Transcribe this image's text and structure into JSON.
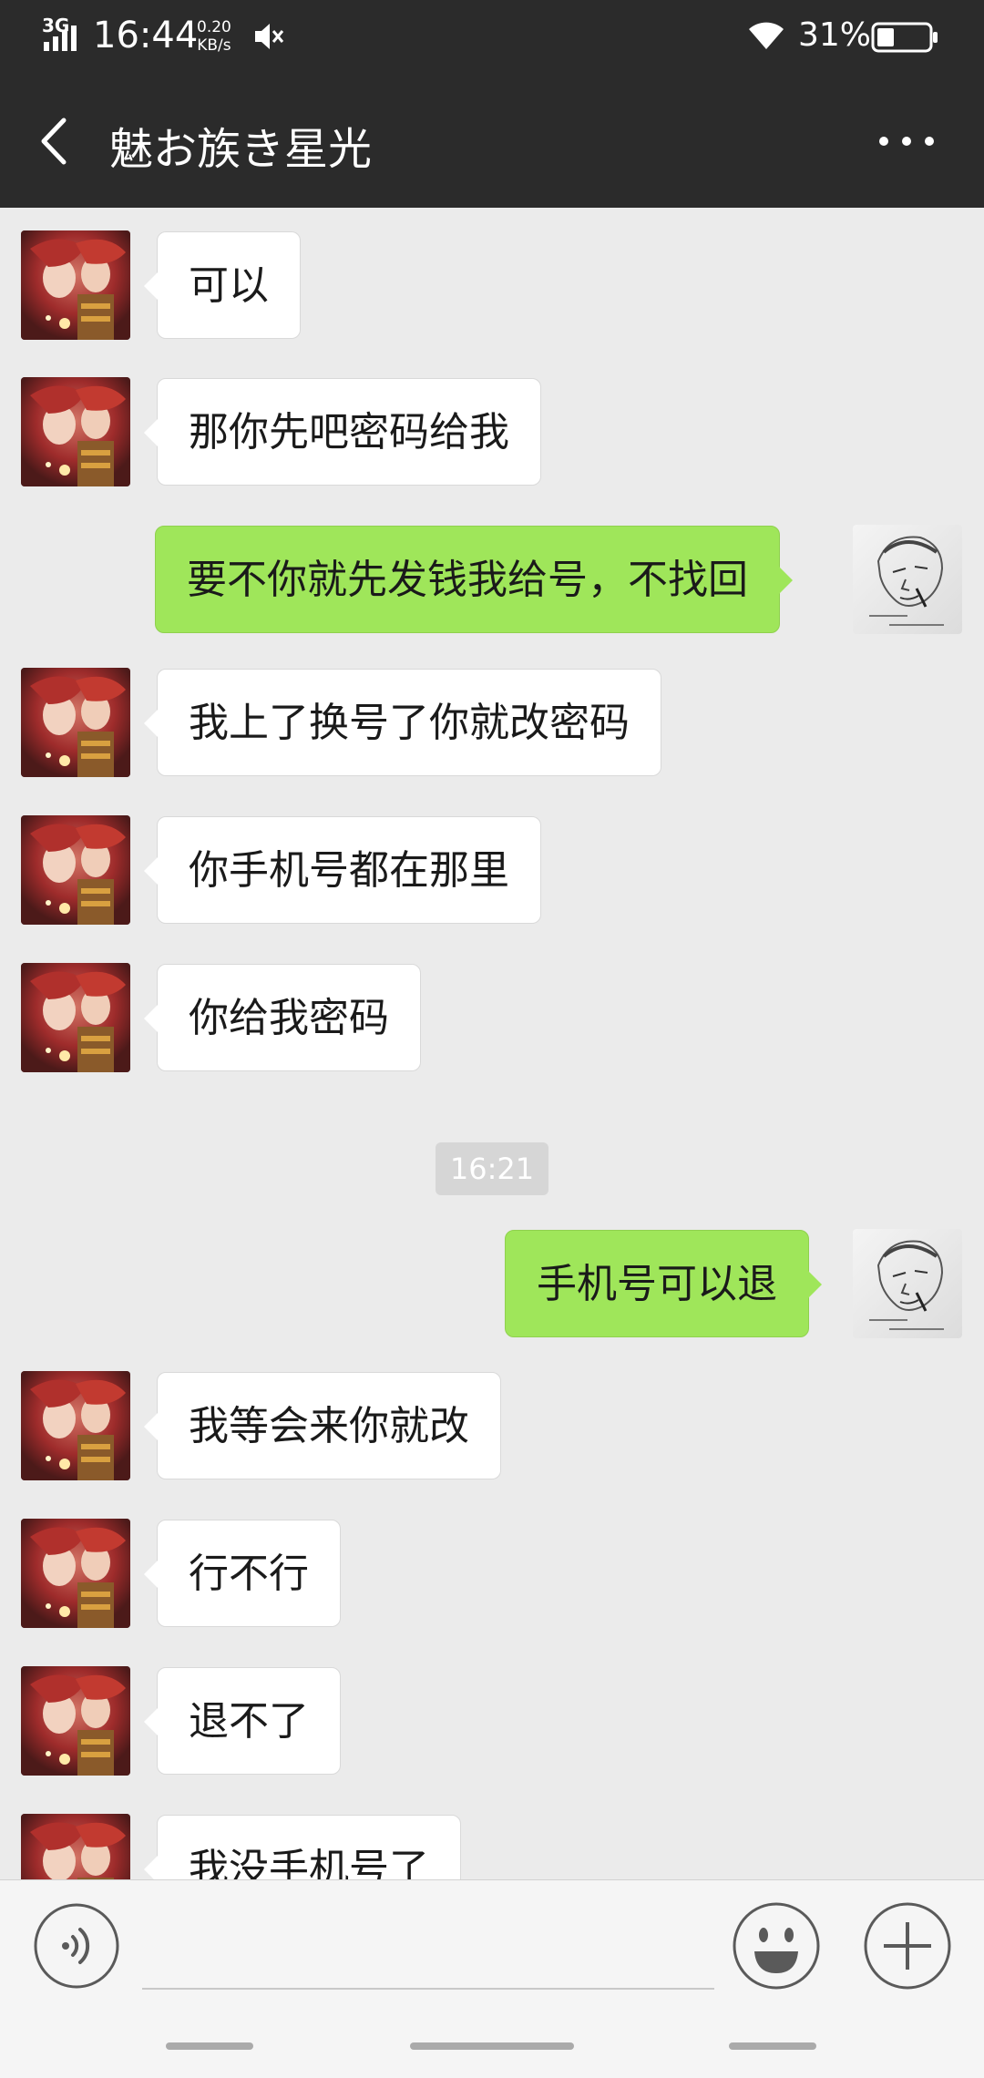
{
  "status_bar": {
    "network": "3G",
    "time": "16:44",
    "speed_value": "0.20",
    "speed_unit": "KB/s",
    "battery_percent": "31%"
  },
  "header": {
    "title": "魅お族き星光",
    "back_icon": "chevron-left-icon",
    "more_icon": "more-icon"
  },
  "messages": [
    {
      "side": "in",
      "text": "可以"
    },
    {
      "side": "in",
      "text": "那你先吧密码给我"
    },
    {
      "side": "out",
      "text": "要不你就先发钱我给号，不找回"
    },
    {
      "side": "in",
      "text": "我上了换号了你就改密码"
    },
    {
      "side": "in",
      "text": "你手机号都在那里"
    },
    {
      "side": "in",
      "text": "你给我密码"
    },
    {
      "side": "out",
      "text": "手机号可以退"
    },
    {
      "side": "in",
      "text": "我等会来你就改"
    },
    {
      "side": "in",
      "text": "行不行"
    },
    {
      "side": "in",
      "text": "退不了"
    },
    {
      "side": "in",
      "text": "我没手机号了"
    }
  ],
  "timestamp": "16:21",
  "input": {
    "value": "",
    "voice_icon": "voice-icon",
    "emoji_icon": "emoji-icon",
    "plus_icon": "plus-icon"
  },
  "colors": {
    "header_bg": "#2b2b2b",
    "chat_bg": "#ebebeb",
    "bubble_in": "#ffffff",
    "bubble_out": "#9fe65a"
  }
}
